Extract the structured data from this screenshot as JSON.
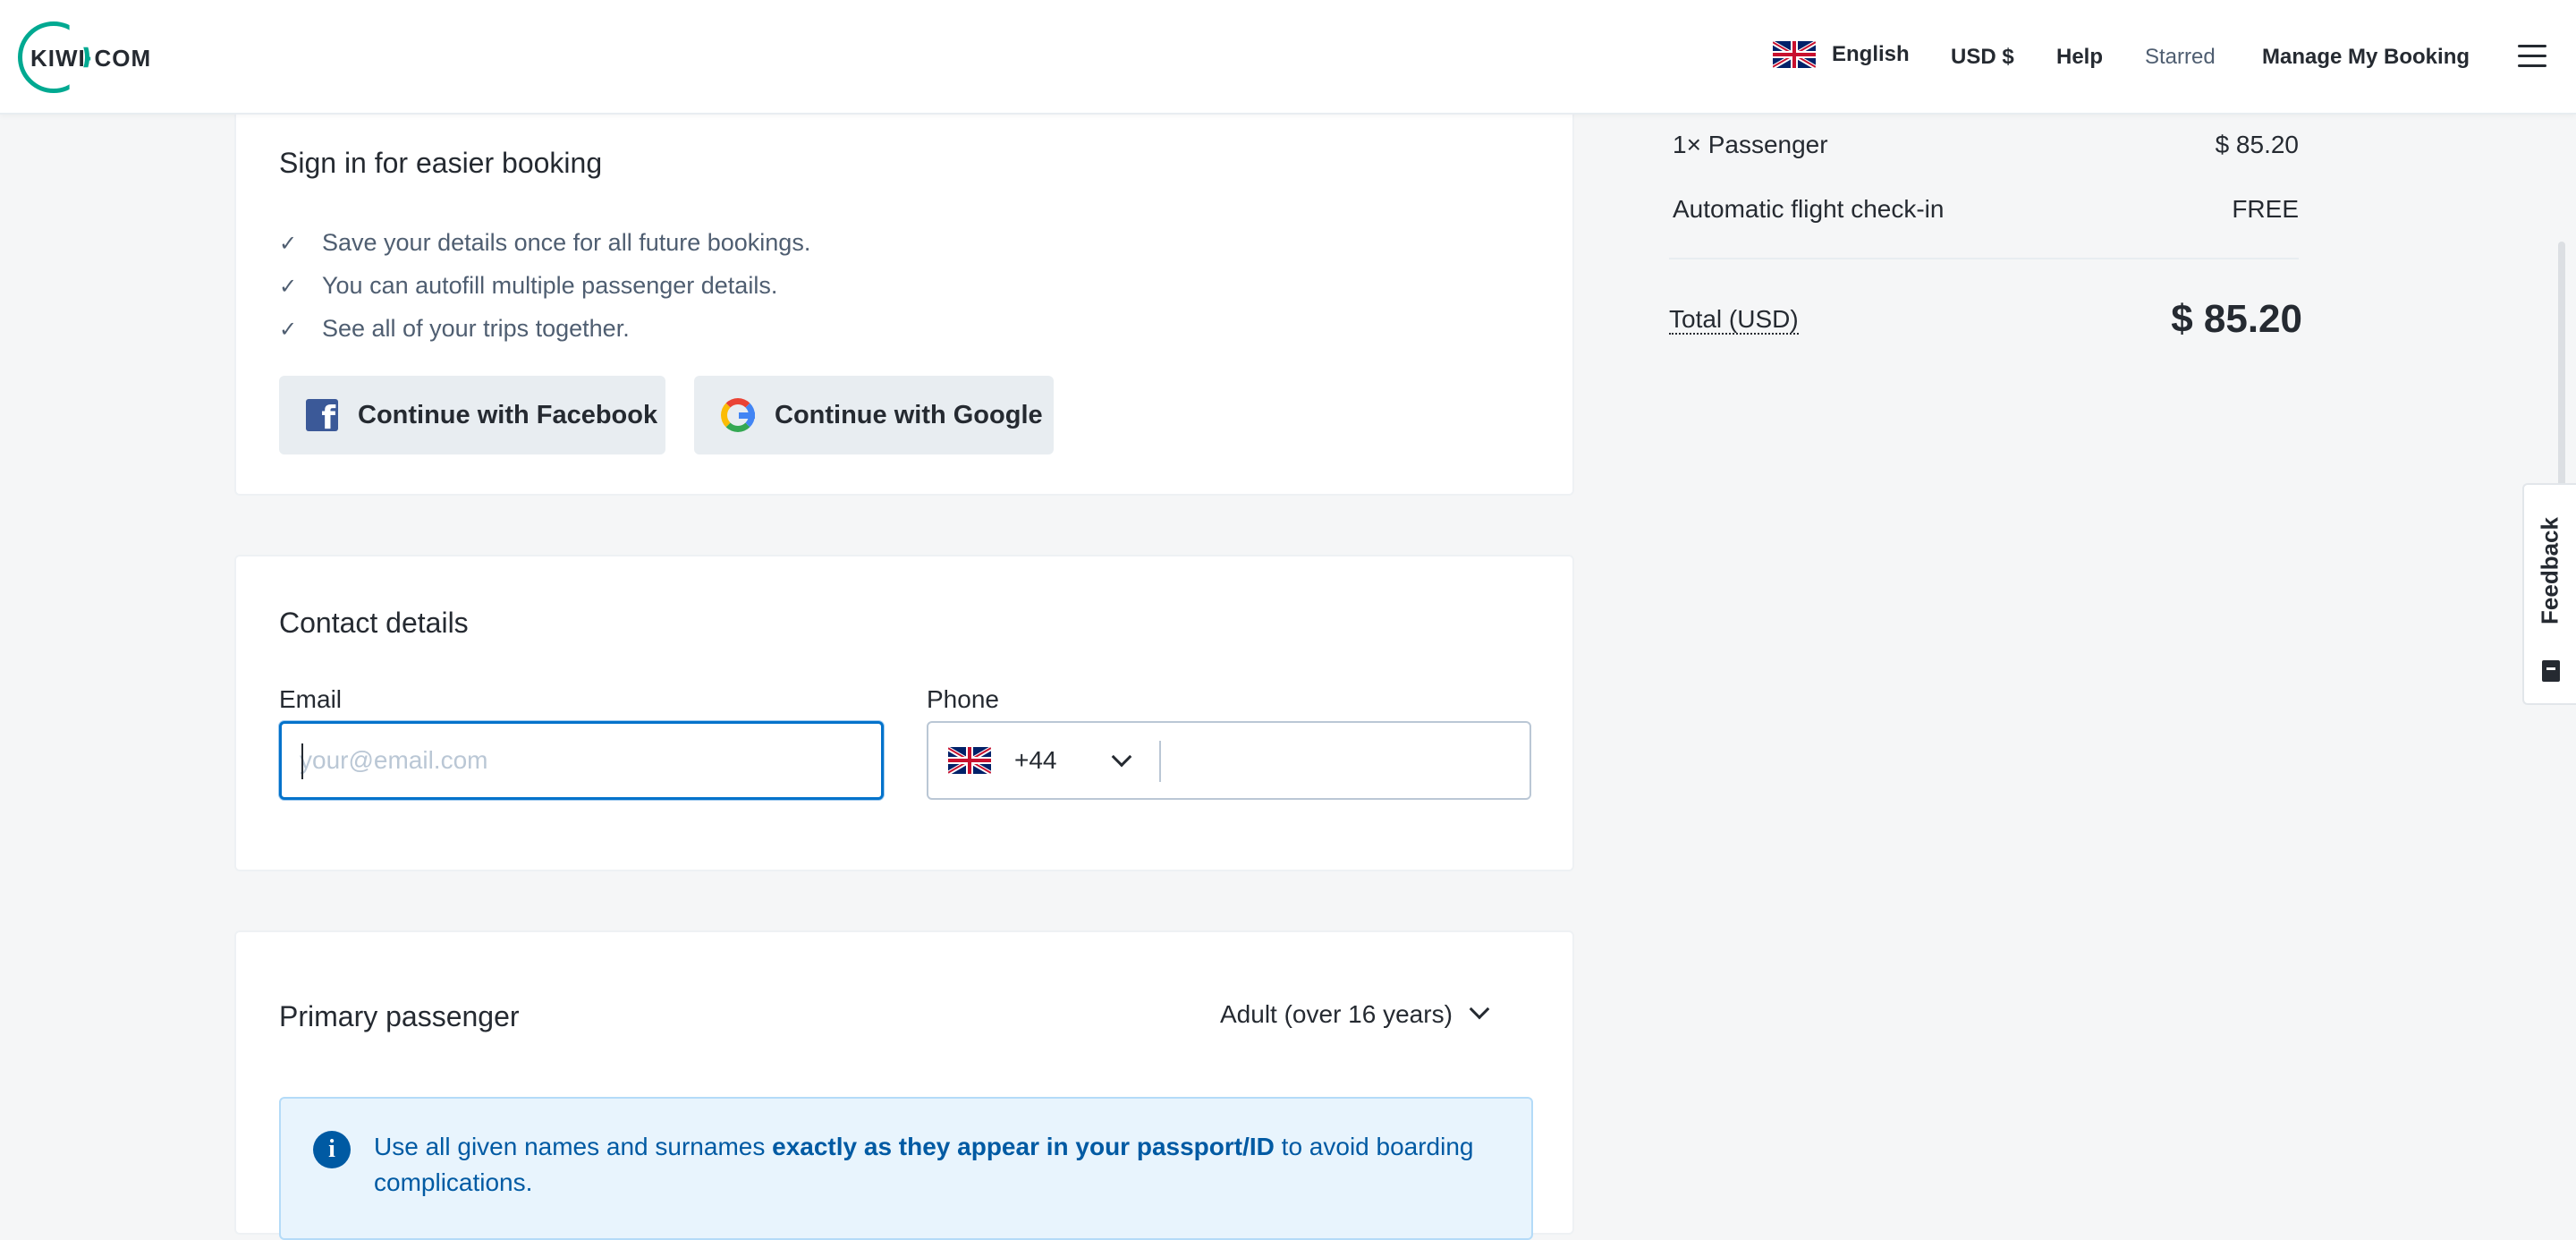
{
  "header": {
    "logo": {
      "text_left": "KIWI",
      "text_dot": "·",
      "text_right": "COM"
    },
    "language_flag": "united-kingdom-flag",
    "language": "English",
    "currency": "USD $",
    "help": "Help",
    "starred": "Starred",
    "manage_booking": "Manage My Booking",
    "menu_icon": "hamburger-icon"
  },
  "signin": {
    "title": "Sign in for easier booking",
    "benefits": [
      "Save your details once for all future bookings.",
      "You can autofill multiple passenger details.",
      "See all of your trips together."
    ],
    "check_icon": "check-icon",
    "facebook_button": "Continue with Facebook",
    "google_button": "Continue with Google"
  },
  "contact": {
    "title": "Contact details",
    "email_label": "Email",
    "email_placeholder": "your@email.com",
    "email_value": "",
    "phone_label": "Phone",
    "phone_country_flag": "united-kingdom-flag",
    "phone_code": "+44",
    "phone_value": ""
  },
  "passenger": {
    "title": "Primary passenger",
    "type_selected": "Adult (over 16 years)",
    "info_icon": "info-icon",
    "info_text_before": "Use all given names and surnames ",
    "info_text_bold": "exactly as they appear in your passport/ID",
    "info_text_after": " to avoid boarding complications."
  },
  "summary": {
    "rows": [
      {
        "label": "1× Passenger",
        "value": "$ 85.20"
      },
      {
        "label": "Automatic flight check-in",
        "value": "FREE"
      }
    ],
    "total_label": "Total (USD)",
    "total_value": "$ 85.20"
  },
  "feedback": {
    "label": "Feedback",
    "icon": "feedback-icon"
  },
  "colors": {
    "brand": "#00a991",
    "focus_border": "#0172cb",
    "info_text": "#005aa3",
    "info_bg": "#e8f4fd",
    "button_bg": "#e8edf1",
    "page_bg": "#f5f6f7"
  }
}
